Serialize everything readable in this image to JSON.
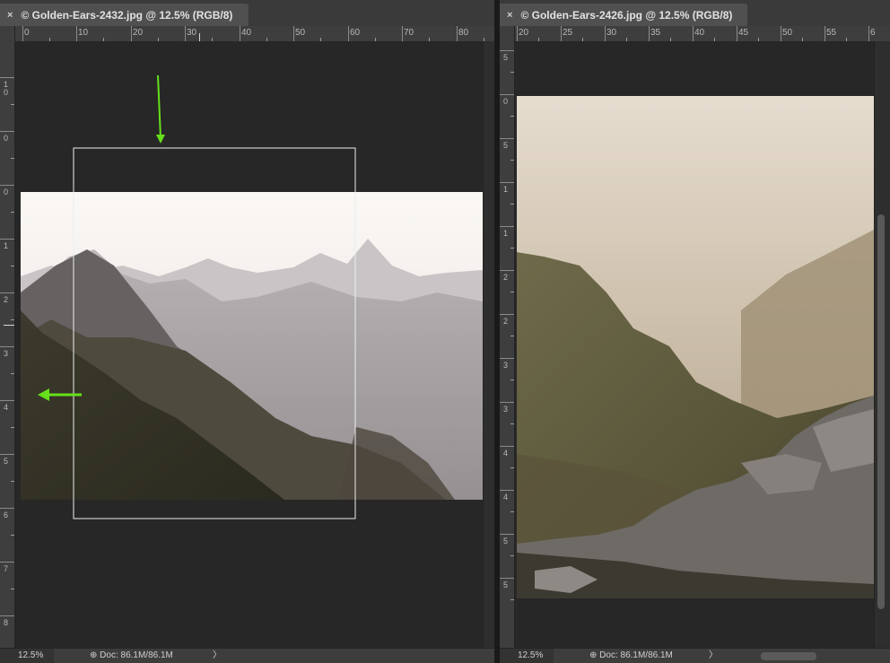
{
  "left_document": {
    "tab_title": "© Golden-Ears-2432.jpg @ 12.5% (RGB/8)",
    "close_glyph": "×",
    "ruler_top": [
      "0",
      "10",
      "20",
      "30",
      "40",
      "50",
      "60",
      "70",
      "80"
    ],
    "ruler_left": [
      "10",
      "0",
      "10",
      "0",
      "1",
      "0",
      "2",
      "0",
      "3",
      "0",
      "4",
      "0",
      "5",
      "0",
      "6",
      "0",
      "7",
      "0",
      "8",
      "0"
    ],
    "zoom": "12.5%",
    "doc_info": "Doc: 86.1M/86.1M",
    "status_arrow": "〉"
  },
  "right_document": {
    "tab_title": "© Golden-Ears-2426.jpg @ 12.5% (RGB/8)",
    "close_glyph": "×",
    "ruler_top": [
      "20",
      "25",
      "30",
      "35",
      "40",
      "45",
      "50",
      "55",
      "6"
    ],
    "ruler_left": [
      "5",
      "0",
      "5",
      "1",
      "0",
      "1",
      "5",
      "2",
      "0",
      "2",
      "5",
      "3",
      "0",
      "3",
      "5",
      "4",
      "0",
      "4",
      "5",
      "5",
      "0",
      "5",
      "5"
    ],
    "zoom": "12.5%",
    "doc_info": "Doc: 86.1M/86.1M",
    "status_arrow": "〉"
  },
  "colors": {
    "annotation_arrow": "#66e01a",
    "canvas_bg": "#272727",
    "panel_bg": "#3e3e3e"
  },
  "icons": {
    "close": "close-icon",
    "doc_info": "doc-info-icon",
    "arrow": "arrow-icon"
  }
}
